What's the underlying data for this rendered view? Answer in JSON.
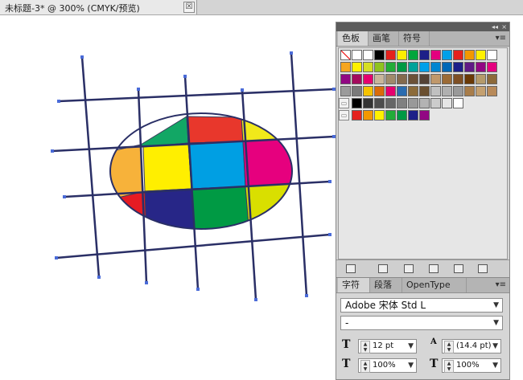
{
  "document": {
    "tab_title": "未标题-3* @ 300% (CMYK/预览)",
    "close_symbol": "☒"
  },
  "artwork": {
    "ellipse_colors": [
      "#f7b23a",
      "#12a765",
      "#e8372c",
      "#f1e91a",
      "#ffef00",
      "#009fe3",
      "#e6007e",
      "#e61b23",
      "#272687",
      "#009a44",
      "#d9df00"
    ],
    "grid_line_color": "#2a2f66",
    "anchor_color": "#4a6bd8"
  },
  "swatches_panel": {
    "collapse_glyph": "◂◂",
    "close_glyph": "×",
    "tabs": [
      "色板",
      "画笔",
      "符号"
    ],
    "menu_glyph": "▾≡",
    "rows": [
      [
        "none",
        "#ffffff",
        "#ffffff",
        "#000000",
        "#e5211d",
        "#ffed00",
        "#00a63c",
        "#1d2088",
        "#e4007f",
        "#00a0e9",
        "#e5211d",
        "#f39800",
        "#fff100",
        "#ffffff"
      ],
      [
        "#f6a620",
        "#fff100",
        "#d6de23",
        "#8fc31f",
        "#22ac38",
        "#009944",
        "#00a29a",
        "#00a0e9",
        "#0086d1",
        "#0068b7",
        "#1d2088",
        "#601986",
        "#920783",
        "#e4007f"
      ],
      [
        "#920783",
        "#a40b5d",
        "#e5006e",
        "#c9b69a",
        "#a08a6b",
        "#846a4d",
        "#6c5137",
        "#544236",
        "#c0986b",
        "#9c6b36",
        "#7e4f25",
        "#6a3906",
        "#b59a6a",
        "#8d6a3a"
      ],
      [
        "#9b9b9b",
        "#7a7a7a",
        "#f5c200",
        "#d96b0a",
        "#e5006e",
        "#2b6cb0",
        "#8c6b3a",
        "#6a4f30",
        "#c0c0c0",
        "#b0b0b0",
        "#999999",
        "#a87d4a",
        "#c4a070",
        "#b88a5a"
      ],
      [
        "#000000",
        "#333333",
        "#4d4d4d",
        "#666666",
        "#808080",
        "#999999",
        "#b3b3b3",
        "#cccccc",
        "#e6e6e6",
        "#ffffff"
      ],
      [
        "#e5211d",
        "#f39800",
        "#fff100",
        "#22ac38",
        "#009944",
        "#1d2088",
        "#920783"
      ]
    ],
    "bottom_icons": [
      "swatch-libraries-icon",
      "show-kinds-icon",
      "swatch-options-icon",
      "new-color-group-icon",
      "new-swatch-icon",
      "delete-swatch-icon"
    ]
  },
  "character_panel": {
    "tabs": [
      "字符",
      "段落",
      "OpenType"
    ],
    "font_family": "Adobe 宋体 Std L",
    "font_style": "-",
    "font_size": "12 pt",
    "leading": "(14.4 pt)",
    "vertical_scale": "100%",
    "horizontal_scale": "100%"
  }
}
